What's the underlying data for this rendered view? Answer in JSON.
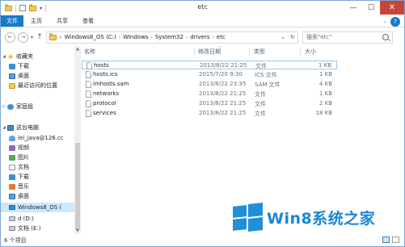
{
  "window": {
    "title": "etc"
  },
  "title_buttons": {
    "minimize": "—",
    "maximize": "☐",
    "close": "✕"
  },
  "ribbon": {
    "tabs": [
      "文件",
      "主页",
      "共享",
      "查看"
    ],
    "help": "?"
  },
  "nav_buttons": {
    "back": "←",
    "forward": "→",
    "up": "↑"
  },
  "address": {
    "prefix": "«",
    "crumbs": [
      "Windows8_OS (C:)",
      "Windows",
      "System32",
      "drivers",
      "etc"
    ],
    "separator": "›",
    "refresh": "↻"
  },
  "search": {
    "placeholder": "搜索\"etc\""
  },
  "nav_pane": {
    "favorites": {
      "label": "收藏夹",
      "items": [
        "下载",
        "桌面",
        "最近访问的位置"
      ]
    },
    "homegroup": {
      "label": "家庭组"
    },
    "this_pc": {
      "label": "这台电脑",
      "items": [
        "lei_java@126.cc",
        "视频",
        "图片",
        "文档",
        "下载",
        "音乐",
        "桌面",
        "Windows8_OS (",
        "d (D:)",
        "文档 (E:)"
      ]
    }
  },
  "columns": {
    "name": "名称",
    "date": "修改日期",
    "type": "类型",
    "size": "大小"
  },
  "files": [
    {
      "name": "hosts",
      "date": "2013/8/22 21:25",
      "type": "文件",
      "size": "1 KB"
    },
    {
      "name": "hosts.ics",
      "date": "2015/7/20 9:30",
      "type": "ICS 文件",
      "size": "1 KB"
    },
    {
      "name": "lmhosts.sam",
      "date": "2013/8/22 23:35",
      "type": "SAM 文件",
      "size": "4 KB"
    },
    {
      "name": "networks",
      "date": "2013/8/22 21:25",
      "type": "文件",
      "size": "1 KB"
    },
    {
      "name": "protocol",
      "date": "2013/8/22 21:25",
      "type": "文件",
      "size": "2 KB"
    },
    {
      "name": "services",
      "date": "2013/8/22 21:25",
      "type": "文件",
      "size": "18 KB"
    }
  ],
  "selected_file_index": 0,
  "status": {
    "count": "6 个项目"
  },
  "watermark": {
    "text": "Win8系统之家"
  },
  "colors": {
    "accent": "#1979ca",
    "close": "#c7443a",
    "selection": "#cce8ff",
    "watermark": "#1a86d1"
  }
}
